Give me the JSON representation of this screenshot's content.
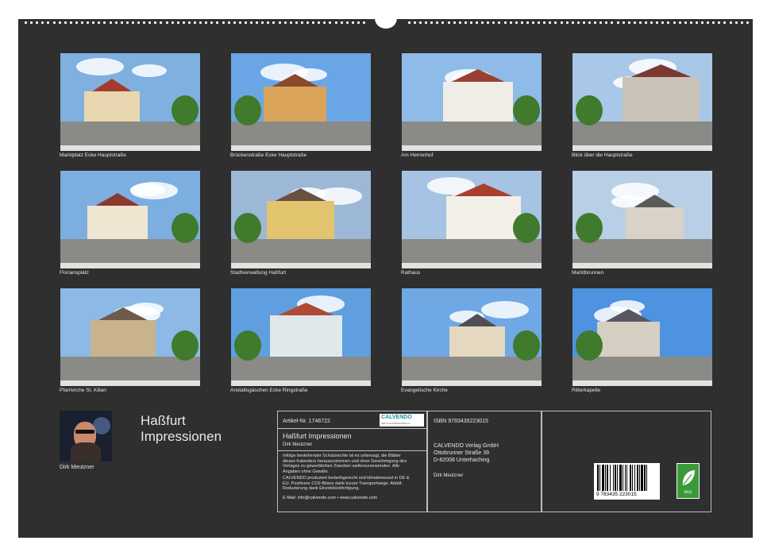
{
  "calendar": {
    "title_line1": "Haßfurt",
    "title_line2": "Impressionen",
    "author": "Dirk Meutzner"
  },
  "photos": [
    {
      "caption": "Marktplatz Ecke Hauptstraße",
      "sky": "#7fb0e0"
    },
    {
      "caption": "Brückenstraße Ecke Hauptstraße",
      "sky": "#6aa6e6"
    },
    {
      "caption": "Am Herrenhof",
      "sky": "#8fbbe8"
    },
    {
      "caption": "Blick über die Hauptstraße",
      "sky": "#a9c7e6"
    },
    {
      "caption": "Floriansplatz",
      "sky": "#7daee0"
    },
    {
      "caption": "Stadtverwaltung Haßfurt",
      "sky": "#9cb8d6"
    },
    {
      "caption": "Rathaus",
      "sky": "#a7c3e3"
    },
    {
      "caption": "Marktbrunnen",
      "sky": "#b9cfe6"
    },
    {
      "caption": "Pfarrkirche St. Kilian",
      "sky": "#8cb9e6"
    },
    {
      "caption": "Anstaltsgäschen Ecke Ringstraße",
      "sky": "#5f9fe0"
    },
    {
      "caption": "Evangelische Kirche",
      "sky": "#6fa8e4"
    },
    {
      "caption": "Ritterkapelle",
      "sky": "#4d93e0"
    }
  ],
  "info": {
    "article": "Artikel-Nr. 1746722",
    "brand": "CALVENDO",
    "brand_sub": "MEIN KALENDERVERLAG",
    "product_title": "Haßfurt Impressionen",
    "product_author": "Dirk Meutzner",
    "notice": "Infolge bestehender Schutzrechte ist es untersagt, die Blätter dieses Kalenders herauszutrennen und ohne Genehmigung des Verlages zu gewerblichen Zwecken weiterzuverwenden. Alle Angaben ohne Gewähr.",
    "eco_note": "CALVENDO produziert bedarfsgerecht und klimabewusst in DE & EU. Positivere CO2-Bilanz dank kurzer Transportwege. Abfall-Reduzierung dank Einzelstückfertigung.",
    "contact": "E-Mail: info@calvendo.com • www.calvendo.com",
    "isbn": "ISBN 9783435223015",
    "publisher": "CALVENDO Verlag GmbH",
    "street": "Ottobrunner Straße 39",
    "city": "D-82008 Unterhaching",
    "photographer": "Dirk Meutzner",
    "barcode_digits": "9 783435 223015",
    "eco_label": "eco"
  }
}
